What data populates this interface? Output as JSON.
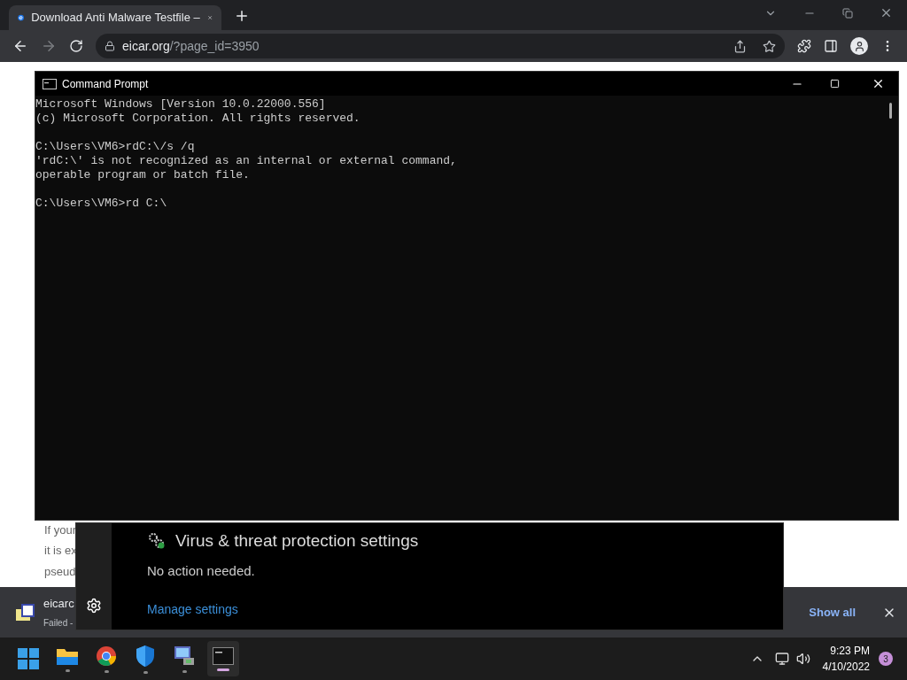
{
  "browser": {
    "tab": {
      "title": "Download Anti Malware Testfile –"
    },
    "address": {
      "domain": "eicar.org",
      "path": "/?page_id=3950"
    }
  },
  "page": {
    "lines": [
      "If your",
      "it is ex",
      "pseud"
    ]
  },
  "console": {
    "title": "Command Prompt",
    "blocks": [
      [
        "Microsoft Windows [Version 10.0.22000.556]",
        "(c) Microsoft Corporation. All rights reserved."
      ],
      [
        "C:\\Users\\VM6>rdC:\\/s /q",
        "'rdC:\\' is not recognized as an internal or external command,",
        "operable program or batch file."
      ],
      [
        "C:\\Users\\VM6>rd C:\\"
      ]
    ]
  },
  "defender": {
    "title": "Virus & threat protection settings",
    "status": "No action needed.",
    "link": "Manage settings"
  },
  "downloads": {
    "items": [
      {
        "name": "eicarc",
        "status": "Failed - "
      }
    ],
    "show_all": "Show all"
  },
  "taskbar": {
    "apps": [
      {
        "kind": "explorer",
        "selected": false
      },
      {
        "kind": "chrome",
        "selected": false
      },
      {
        "kind": "shield",
        "selected": false
      },
      {
        "kind": "remote",
        "selected": false
      },
      {
        "kind": "terminal",
        "selected": true
      }
    ],
    "clock": {
      "time": "9:23 PM",
      "date": "4/10/2022"
    },
    "notifications": "3"
  }
}
